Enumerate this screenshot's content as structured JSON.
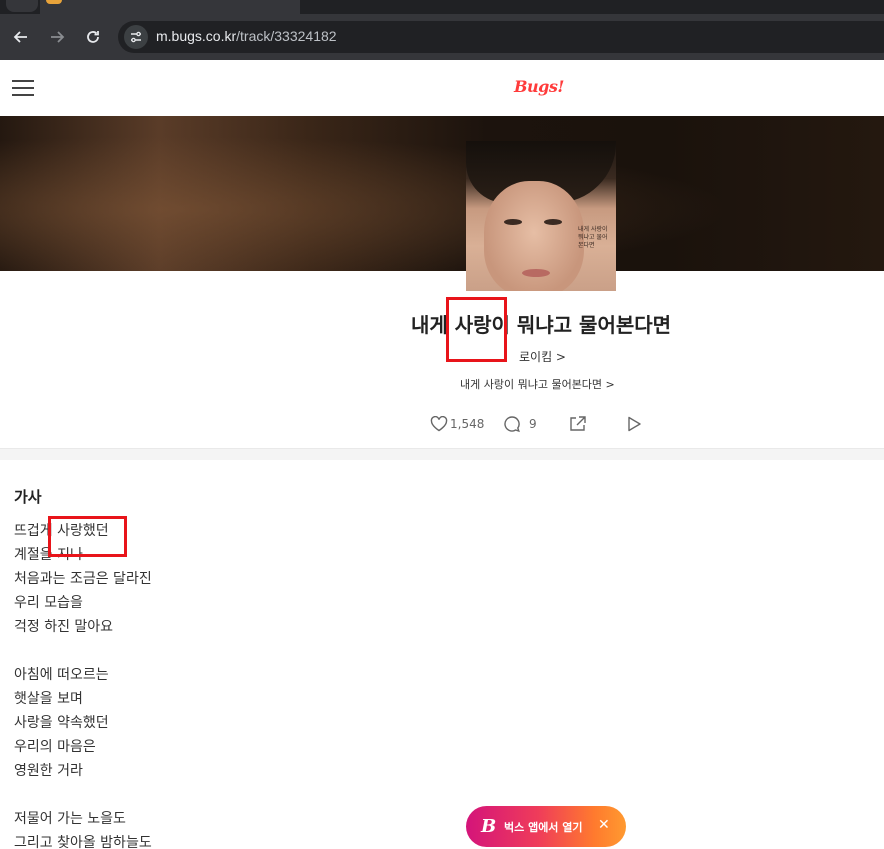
{
  "browser": {
    "url_host": "m.bugs.co.kr",
    "url_path": "/track/33324182"
  },
  "header": {
    "logo": "Bugs!"
  },
  "cover": {
    "text": "내게 사랑이 뭐냐고 물어본다면"
  },
  "track": {
    "title": "내게 사랑이 뭐냐고 물어본다면",
    "artist": "로이킴 >",
    "album": "내게 사랑이 뭐냐고 물어본다면 >",
    "likes": "1,548",
    "comments": "9"
  },
  "lyrics": {
    "heading": "가사",
    "lines": [
      "뜨겁게 사랑했던",
      "계절을 지나",
      "처음과는 조금은 달라진",
      "우리 모습을",
      "걱정 하진 말아요",
      "",
      "아침에 떠오르는",
      "햇살을 보며",
      "사랑을 약속했던",
      "우리의 마음은",
      "영원한 거라",
      "",
      "저물어 가는 노을도",
      "그리고 찾아올 밤하늘도"
    ]
  },
  "app_button": {
    "label": "벅스 앱에서 열기",
    "icon": "B"
  },
  "colors": {
    "brand": "#ff3b3b",
    "highlight": "#e8141a",
    "button_gradient_start": "#d4147a",
    "button_gradient_end": "#ff9a30"
  }
}
